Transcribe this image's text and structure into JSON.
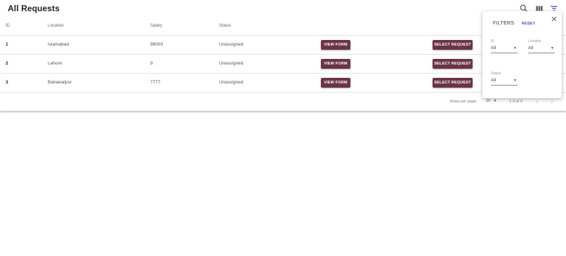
{
  "header": {
    "title": "All Requests"
  },
  "toolbar": {
    "search_icon": "search-icon",
    "columns_icon": "view-column-icon",
    "filter_icon": "filter-icon",
    "filter_active_color": "#4a54b8"
  },
  "table": {
    "columns": [
      "ID",
      "Location",
      "Salary",
      "Status"
    ],
    "rows": [
      {
        "id": "1",
        "location": "Islamabad",
        "salary": "98000",
        "status": "Unassigned",
        "view_label": "VIEW FORM",
        "select_label": "SELECT REQUEST"
      },
      {
        "id": "2",
        "location": "Lahore",
        "salary": "9",
        "status": "Unassigned",
        "view_label": "VIEW FORM",
        "select_label": "SELECT REQUEST"
      },
      {
        "id": "3",
        "location": "Bahawalpur",
        "salary": "7777",
        "status": "Unassigned",
        "view_label": "VIEW FORM",
        "select_label": "SELECT REQUEST"
      }
    ]
  },
  "footer": {
    "rows_per_page_label": "Rows per page:",
    "rows_per_page_value": "10",
    "range": "1-3 of 3",
    "prev_glyph": "‹",
    "next_glyph": "›"
  },
  "filters": {
    "title": "FILTERS",
    "reset_label": "RESET",
    "fields": [
      {
        "label": "ID",
        "value": "All"
      },
      {
        "label": "Location",
        "value": "All"
      },
      {
        "label": "Status",
        "value": "All"
      }
    ]
  },
  "colors": {
    "button_bg": "#6b3348",
    "accent": "#4a54b8"
  }
}
